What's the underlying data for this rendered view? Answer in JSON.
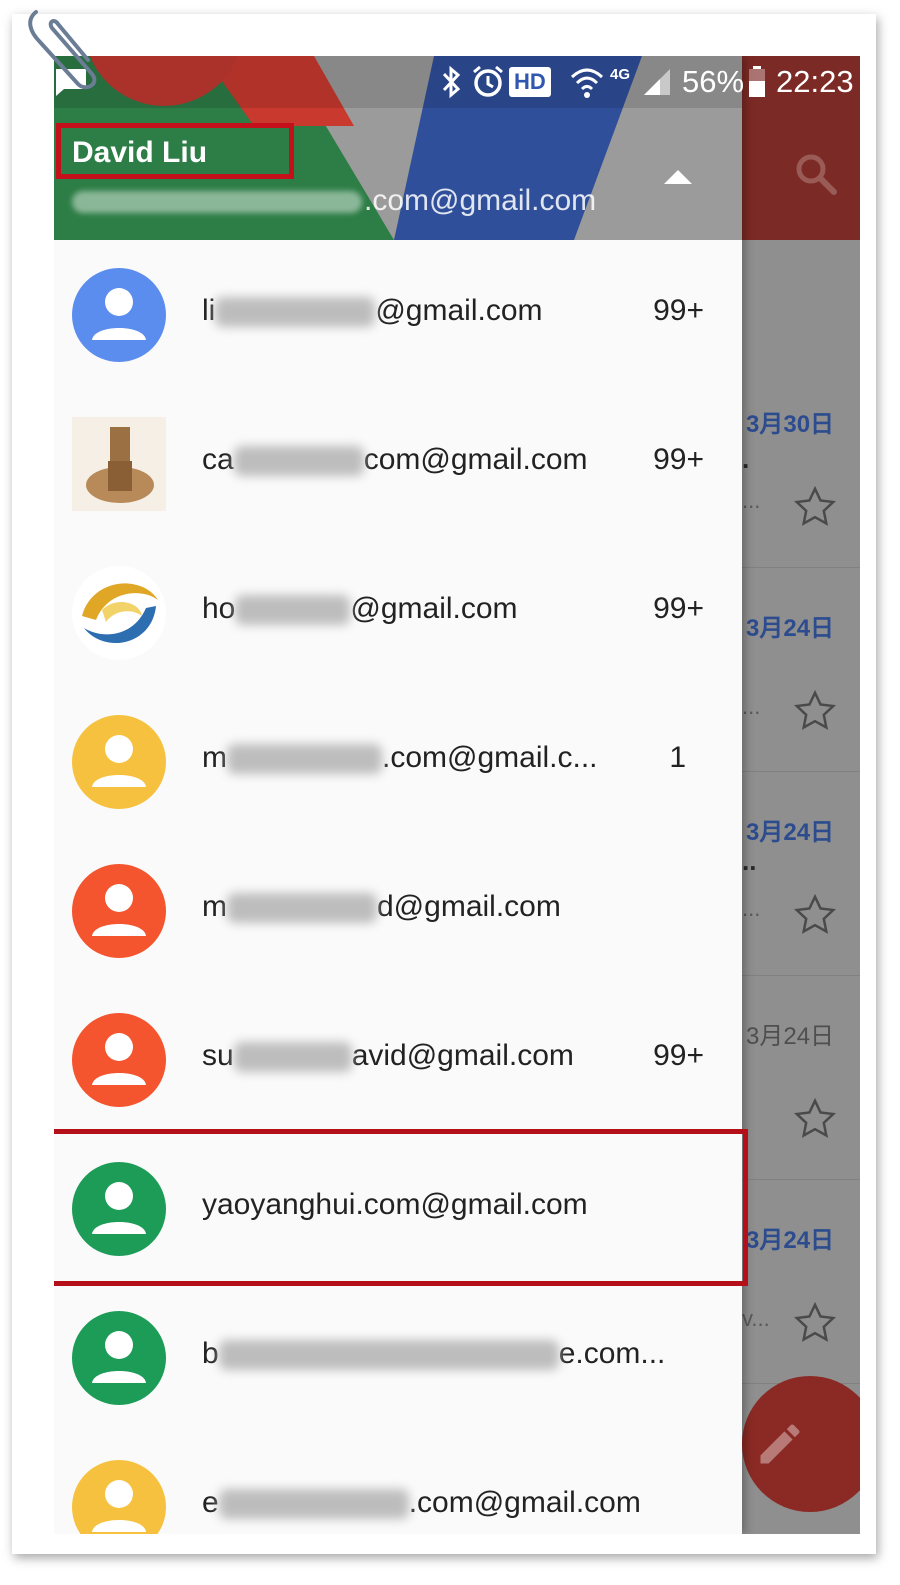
{
  "status_bar": {
    "hd_label": "HD",
    "network_label": "4G",
    "battery": "56%",
    "time": "22:23"
  },
  "drawer": {
    "account_name": "David Liu",
    "account_email_visible": ".com@gmail.com",
    "accounts": [
      {
        "prefix": "li",
        "suffix": "@gmail.com",
        "count": "99+",
        "avatar_color": "#5b8def",
        "avatar_type": "default"
      },
      {
        "prefix": "ca",
        "suffix": "com@gmail.com",
        "count": "99+",
        "avatar_color": "#b0865a",
        "avatar_type": "photo"
      },
      {
        "prefix": "ho",
        "suffix": "@gmail.com",
        "count": "99+",
        "avatar_color": "#d9a520",
        "avatar_type": "logo"
      },
      {
        "prefix": "m",
        "suffix": ".com@gmail.c...",
        "count": "1",
        "avatar_color": "#f6c13e",
        "avatar_type": "default"
      },
      {
        "prefix": "m",
        "suffix": "d@gmail.com",
        "count": "",
        "avatar_color": "#f4542e",
        "avatar_type": "default"
      },
      {
        "prefix": "su",
        "suffix": "avid@gmail.com",
        "count": "99+",
        "avatar_color": "#f4542e",
        "avatar_type": "default"
      },
      {
        "prefix": "",
        "suffix": "yaoyanghui.com@gmail.com",
        "count": "",
        "avatar_color": "#1c9c57",
        "avatar_type": "default"
      },
      {
        "prefix": "b",
        "suffix": "e.com...",
        "count": "",
        "avatar_color": "#1c9c57",
        "avatar_type": "default"
      },
      {
        "prefix": "e",
        "suffix": ".com@gmail.com",
        "count": "",
        "avatar_color": "#f6c13e",
        "avatar_type": "default"
      }
    ]
  },
  "background_list": {
    "dates": [
      "3月30日",
      "3月24日",
      "3月24日",
      "3月24日",
      "3月24日"
    ],
    "snippet_fragments": [
      ".",
      "..",
      "...",
      "...",
      "...",
      "v..."
    ]
  },
  "colors": {
    "highlight_red": "#c4101a",
    "toolbar_dim": "#7c2a25",
    "date_blue": "#2d4c8f"
  }
}
